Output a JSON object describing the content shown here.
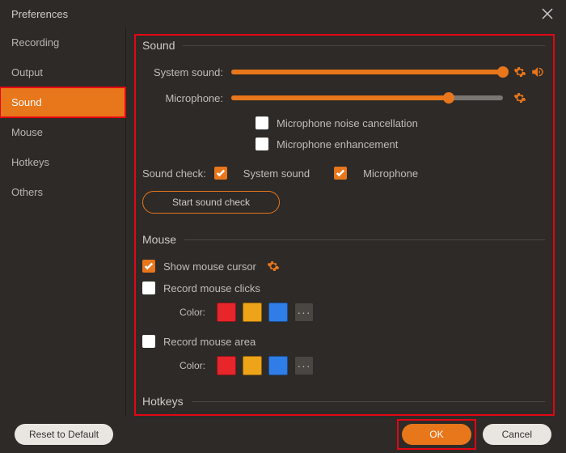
{
  "window": {
    "title": "Preferences"
  },
  "sidebar": {
    "items": [
      {
        "label": "Recording",
        "active": false
      },
      {
        "label": "Output",
        "active": false
      },
      {
        "label": "Sound",
        "active": true
      },
      {
        "label": "Mouse",
        "active": false
      },
      {
        "label": "Hotkeys",
        "active": false
      },
      {
        "label": "Others",
        "active": false
      }
    ]
  },
  "sound": {
    "heading": "Sound",
    "system_label": "System sound:",
    "system_value": 100,
    "mic_label": "Microphone:",
    "mic_value": 80,
    "noise_cancel": {
      "label": "Microphone noise cancellation",
      "checked": false
    },
    "enhancement": {
      "label": "Microphone enhancement",
      "checked": false
    },
    "check_label": "Sound check:",
    "check_system": {
      "label": "System sound",
      "checked": true
    },
    "check_mic": {
      "label": "Microphone",
      "checked": true
    },
    "start_btn": "Start sound check"
  },
  "mouse": {
    "heading": "Mouse",
    "show_cursor": {
      "label": "Show mouse cursor",
      "checked": true
    },
    "record_clicks": {
      "label": "Record mouse clicks",
      "checked": false
    },
    "record_area": {
      "label": "Record mouse area",
      "checked": false
    },
    "color_label": "Color:",
    "more": "···",
    "colors": [
      "#e6262a",
      "#eea418",
      "#2f7ee8"
    ]
  },
  "hotkeys": {
    "heading": "Hotkeys"
  },
  "footer": {
    "reset": "Reset to Default",
    "ok": "OK",
    "cancel": "Cancel"
  }
}
